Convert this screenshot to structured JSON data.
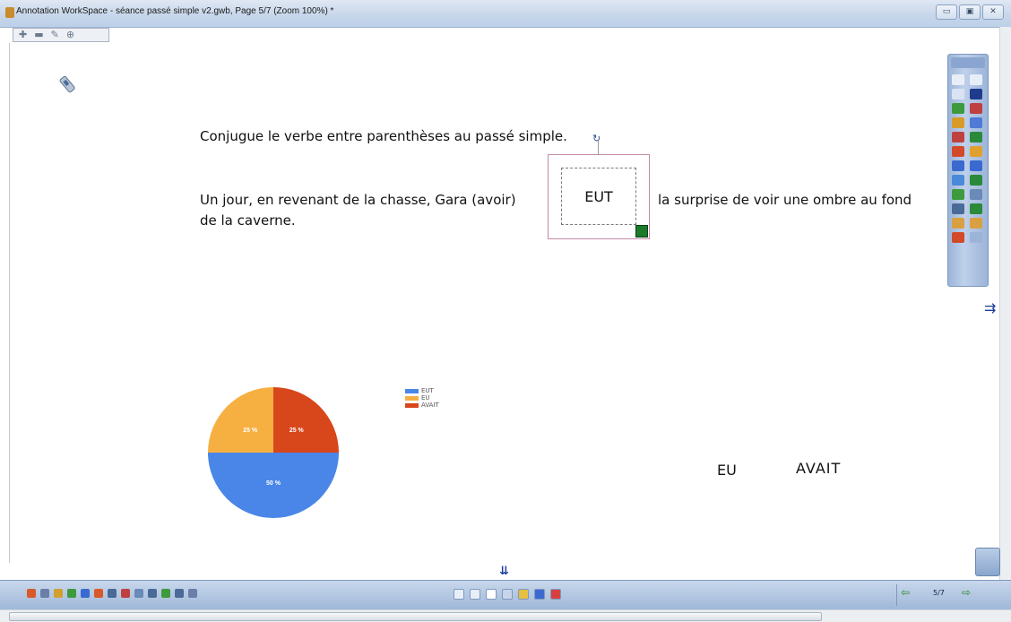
{
  "window": {
    "title": "Annotation WorkSpace - séance passé simple v2.gwb, Page 5/7  (Zoom 100%) *",
    "controls": [
      "▭",
      "▣",
      "✕"
    ]
  },
  "mini_toolbar": [
    "✚",
    "▬",
    "✎",
    "⊕"
  ],
  "slide": {
    "instruction": "Conjugue le verbe entre parenthèses au passé simple.",
    "sentence_part1_line1": "Un jour, en revenant de la chasse, Gara (avoir)",
    "sentence_part1_line2": "de la caverne.",
    "sentence_part2": "la surprise de voir une ombre au fond",
    "answer_box_text": "EUT",
    "option_eu": "EU",
    "option_avait": "AVAIT"
  },
  "chart_data": {
    "type": "pie",
    "series": [
      {
        "name": "EUT",
        "value": 50,
        "label": "50 %",
        "color": "#4a86e8"
      },
      {
        "name": "EU",
        "value": 25,
        "label": "25 %",
        "color": "#f6b042"
      },
      {
        "name": "AVAIT",
        "value": 25,
        "label": "25 %",
        "color": "#d8461c"
      }
    ],
    "legend_position": "right"
  },
  "colors": {
    "eut": "#4a86e8",
    "eu": "#f6b042",
    "avait": "#d8461c",
    "toolbar": "#9fb8d8"
  },
  "bottom": {
    "page_indicator": "5/7"
  }
}
